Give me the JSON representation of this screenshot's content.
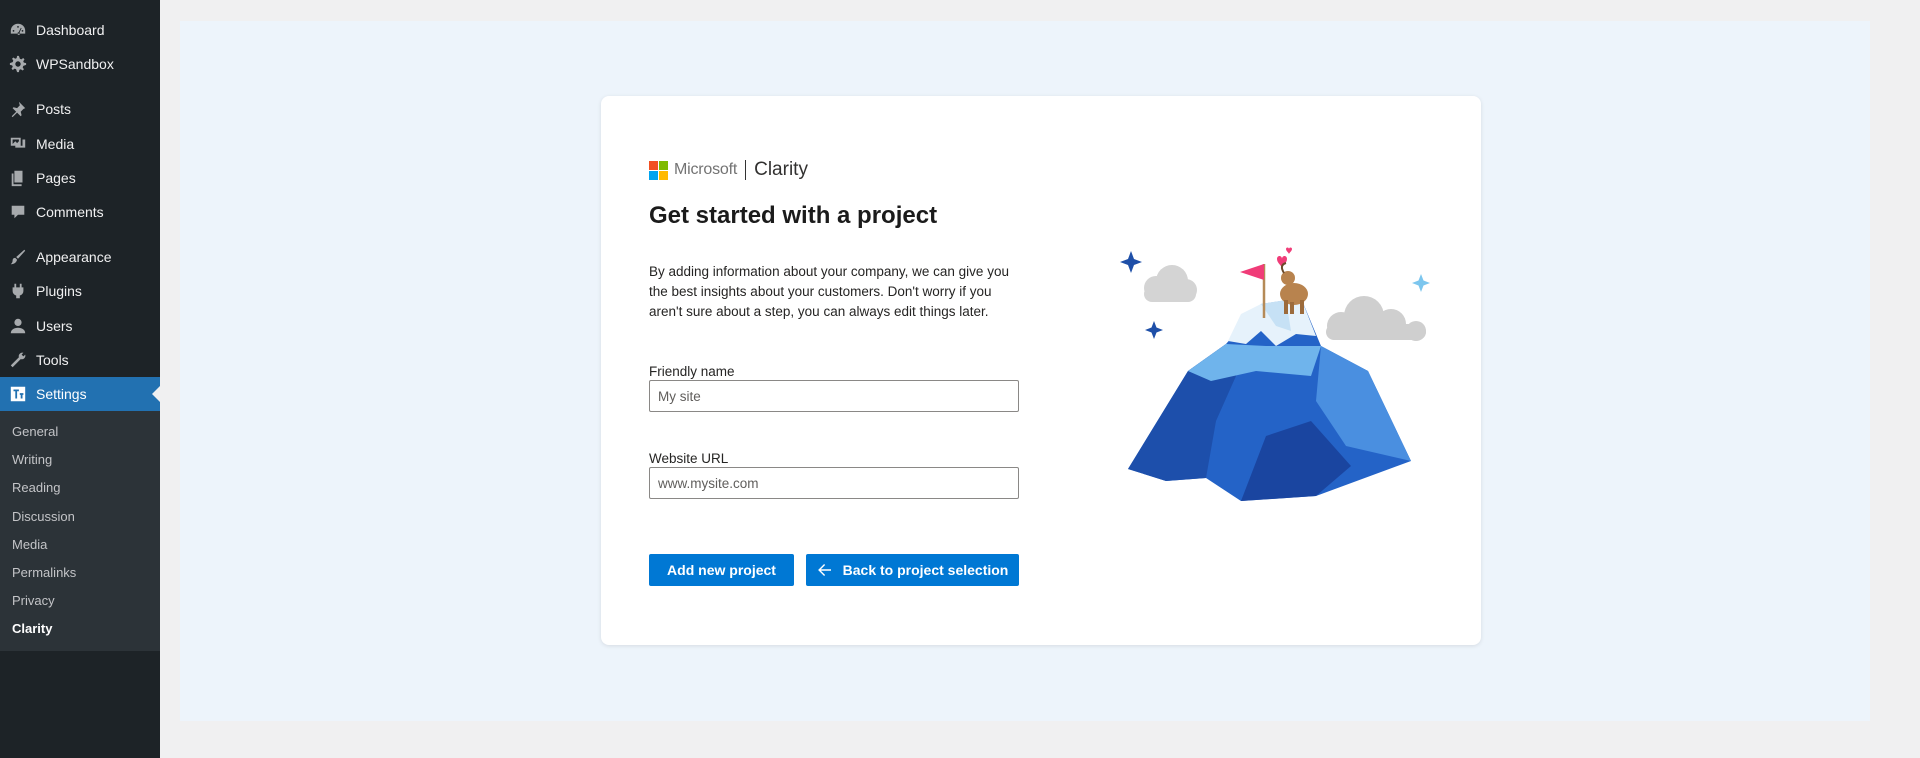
{
  "sidebar": {
    "items": [
      {
        "label": "Dashboard",
        "icon": "dashboard-icon"
      },
      {
        "label": "WPSandbox",
        "icon": "gear-icon"
      },
      {
        "label": "Posts",
        "icon": "pin-icon"
      },
      {
        "label": "Media",
        "icon": "media-icon"
      },
      {
        "label": "Pages",
        "icon": "pages-icon"
      },
      {
        "label": "Comments",
        "icon": "comment-icon"
      },
      {
        "label": "Appearance",
        "icon": "brush-icon"
      },
      {
        "label": "Plugins",
        "icon": "plug-icon"
      },
      {
        "label": "Users",
        "icon": "user-icon"
      },
      {
        "label": "Tools",
        "icon": "wrench-icon"
      },
      {
        "label": "Settings",
        "icon": "settings-icon",
        "current": true
      }
    ],
    "submenu": [
      "General",
      "Writing",
      "Reading",
      "Discussion",
      "Media",
      "Permalinks",
      "Privacy",
      "Clarity"
    ],
    "submenu_current": "Clarity"
  },
  "card": {
    "logo": {
      "brand": "Microsoft",
      "product": "Clarity"
    },
    "title": "Get started with a project",
    "intro": "By adding information about your company, we can give you the best insights about your customers. Don't worry if you aren't sure about a step, you can always edit things later.",
    "fields": {
      "friendly_name": {
        "label": "Friendly name",
        "placeholder": "My site"
      },
      "website_url": {
        "label": "Website URL",
        "placeholder": "www.mysite.com"
      }
    },
    "buttons": {
      "add": "Add new project",
      "back": "Back to project selection"
    }
  },
  "colors": {
    "sidebar_bg": "#1d2327",
    "sidebar_current": "#2271b1",
    "content_bg": "#edf4fb",
    "primary_button": "#0078d4"
  }
}
